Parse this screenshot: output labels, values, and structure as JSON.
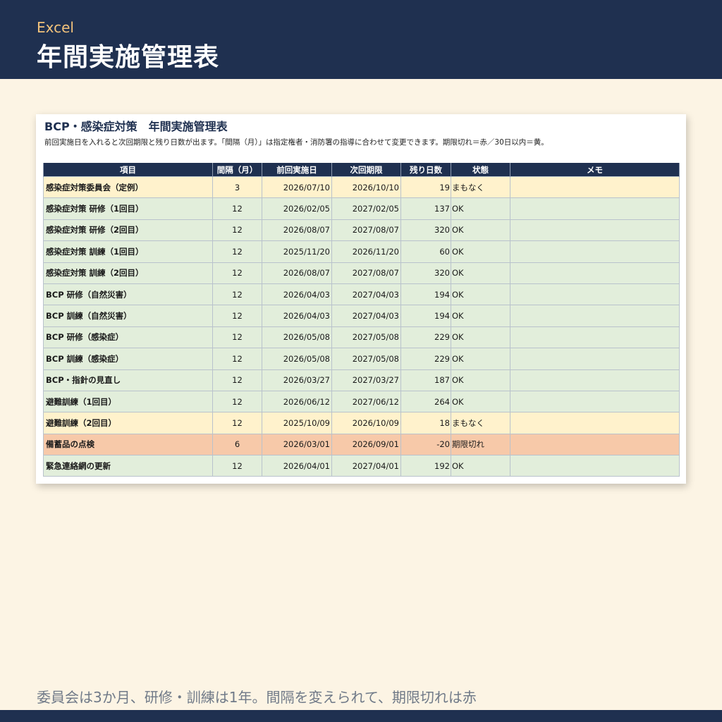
{
  "header": {
    "app_name": "Excel",
    "title": "年間実施管理表"
  },
  "sheet": {
    "title": "BCP・感染症対策　年間実施管理表",
    "subtitle": "前回実施日を入れると次回期限と残り日数が出ます。「間隔（月）」は指定権者・消防署の指導に合わせて変更できます。期限切れ＝赤／30日以内＝黄。",
    "columns": [
      "項目",
      "間隔（月）",
      "前回実施日",
      "次回期限",
      "残り日数",
      "状態",
      "メモ"
    ],
    "rows": [
      {
        "item": "感染症対策委員会（定例）",
        "interval": "3",
        "last": "2026/07/10",
        "next": "2026/10/10",
        "days": "19",
        "status": "まもなく",
        "memo": "",
        "state": "soon"
      },
      {
        "item": "感染症対策 研修（1回目）",
        "interval": "12",
        "last": "2026/02/05",
        "next": "2027/02/05",
        "days": "137",
        "status": "OK",
        "memo": "",
        "state": "ok"
      },
      {
        "item": "感染症対策 研修（2回目）",
        "interval": "12",
        "last": "2026/08/07",
        "next": "2027/08/07",
        "days": "320",
        "status": "OK",
        "memo": "",
        "state": "ok"
      },
      {
        "item": "感染症対策 訓練（1回目）",
        "interval": "12",
        "last": "2025/11/20",
        "next": "2026/11/20",
        "days": "60",
        "status": "OK",
        "memo": "",
        "state": "ok"
      },
      {
        "item": "感染症対策 訓練（2回目）",
        "interval": "12",
        "last": "2026/08/07",
        "next": "2027/08/07",
        "days": "320",
        "status": "OK",
        "memo": "",
        "state": "ok"
      },
      {
        "item": "BCP 研修（自然災害）",
        "interval": "12",
        "last": "2026/04/03",
        "next": "2027/04/03",
        "days": "194",
        "status": "OK",
        "memo": "",
        "state": "ok"
      },
      {
        "item": "BCP 訓練（自然災害）",
        "interval": "12",
        "last": "2026/04/03",
        "next": "2027/04/03",
        "days": "194",
        "status": "OK",
        "memo": "",
        "state": "ok"
      },
      {
        "item": "BCP 研修（感染症）",
        "interval": "12",
        "last": "2026/05/08",
        "next": "2027/05/08",
        "days": "229",
        "status": "OK",
        "memo": "",
        "state": "ok"
      },
      {
        "item": "BCP 訓練（感染症）",
        "interval": "12",
        "last": "2026/05/08",
        "next": "2027/05/08",
        "days": "229",
        "status": "OK",
        "memo": "",
        "state": "ok"
      },
      {
        "item": "BCP・指針の見直し",
        "interval": "12",
        "last": "2026/03/27",
        "next": "2027/03/27",
        "days": "187",
        "status": "OK",
        "memo": "",
        "state": "ok"
      },
      {
        "item": "避難訓練（1回目）",
        "interval": "12",
        "last": "2026/06/12",
        "next": "2027/06/12",
        "days": "264",
        "status": "OK",
        "memo": "",
        "state": "ok"
      },
      {
        "item": "避難訓練（2回目）",
        "interval": "12",
        "last": "2025/10/09",
        "next": "2026/10/09",
        "days": "18",
        "status": "まもなく",
        "memo": "",
        "state": "soon"
      },
      {
        "item": "備蓄品の点検",
        "interval": "6",
        "last": "2026/03/01",
        "next": "2026/09/01",
        "days": "-20",
        "status": "期限切れ",
        "memo": "",
        "state": "expired"
      },
      {
        "item": "緊急連絡網の更新",
        "interval": "12",
        "last": "2026/04/01",
        "next": "2027/04/01",
        "days": "192",
        "status": "OK",
        "memo": "",
        "state": "ok"
      }
    ]
  },
  "caption": "委員会は3か月、研修・訓練は1年。間隔を変えられて、期限切れは赤",
  "colors": {
    "navy": "#1f3050",
    "ok_fill": "#e2eedb",
    "soon_fill": "#fff2cc",
    "expired_fill": "#f7c9a9",
    "accent_orange": "#f2c27b"
  }
}
